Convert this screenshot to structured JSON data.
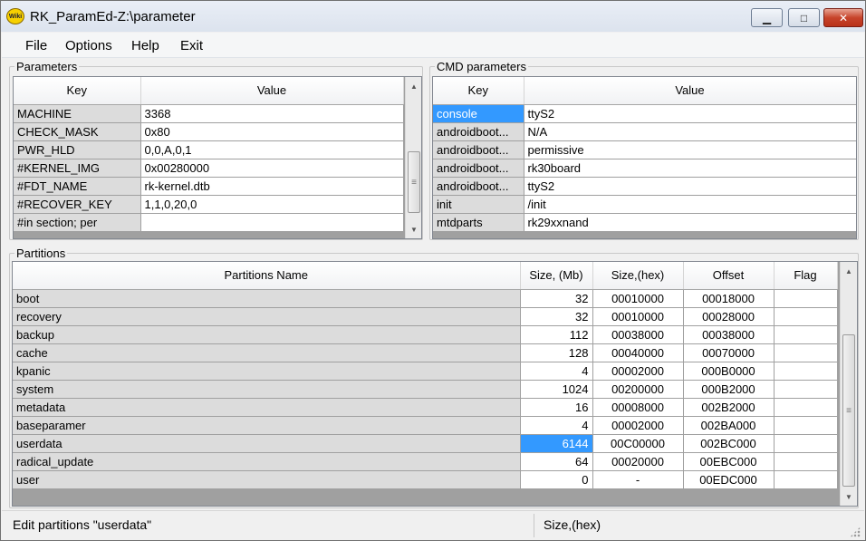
{
  "window": {
    "title": "RK_ParamEd-Z:\\parameter",
    "icon_name": "app-logo-icon",
    "icon_text": "Wiki",
    "controls": {
      "minimize": "▁",
      "maximize": "□",
      "close": "✕"
    }
  },
  "menu": [
    "File",
    "Options",
    "Help",
    "Exit"
  ],
  "parameters": {
    "title": "Parameters",
    "headers": [
      "Key",
      "Value"
    ],
    "rows": [
      [
        "MACHINE",
        "3368"
      ],
      [
        "CHECK_MASK",
        "0x80"
      ],
      [
        "PWR_HLD",
        "0,0,A,0,1"
      ],
      [
        "#KERNEL_IMG",
        "0x00280000"
      ],
      [
        "#FDT_NAME",
        "rk-kernel.dtb"
      ],
      [
        "#RECOVER_KEY",
        "1,1,0,20,0"
      ],
      [
        "#in section; per",
        ""
      ]
    ]
  },
  "cmd_parameters": {
    "title": "CMD parameters",
    "headers": [
      "Key",
      "Value"
    ],
    "rows": [
      [
        "console",
        "ttyS2"
      ],
      [
        "androidboot...",
        "N/A"
      ],
      [
        "androidboot...",
        "permissive"
      ],
      [
        "androidboot...",
        "rk30board"
      ],
      [
        "androidboot...",
        "ttyS2"
      ],
      [
        "init",
        "/init"
      ],
      [
        "mtdparts",
        "rk29xxnand"
      ]
    ],
    "selected_row": 0
  },
  "partitions": {
    "title": "Partitions",
    "headers": [
      "Partitions Name",
      "Size, (Mb)",
      "Size,(hex)",
      "Offset",
      "Flag"
    ],
    "rows": [
      [
        "boot",
        "32",
        "00010000",
        "00018000",
        ""
      ],
      [
        "recovery",
        "32",
        "00010000",
        "00028000",
        ""
      ],
      [
        "backup",
        "112",
        "00038000",
        "00038000",
        ""
      ],
      [
        "cache",
        "128",
        "00040000",
        "00070000",
        ""
      ],
      [
        "kpanic",
        "4",
        "00002000",
        "000B0000",
        ""
      ],
      [
        "system",
        "1024",
        "00200000",
        "000B2000",
        ""
      ],
      [
        "metadata",
        "16",
        "00008000",
        "002B2000",
        ""
      ],
      [
        "baseparamer",
        "4",
        "00002000",
        "002BA000",
        ""
      ],
      [
        "userdata",
        "6144",
        "00C00000",
        "002BC000",
        ""
      ],
      [
        "radical_update",
        "64",
        "00020000",
        "00EBC000",
        ""
      ],
      [
        "user",
        "0",
        "-",
        "00EDC000",
        ""
      ]
    ],
    "selected_cell": {
      "row": 8,
      "col": 1
    }
  },
  "status": {
    "left": "Edit partitions \"userdata\"",
    "right": "Size,(hex)"
  }
}
